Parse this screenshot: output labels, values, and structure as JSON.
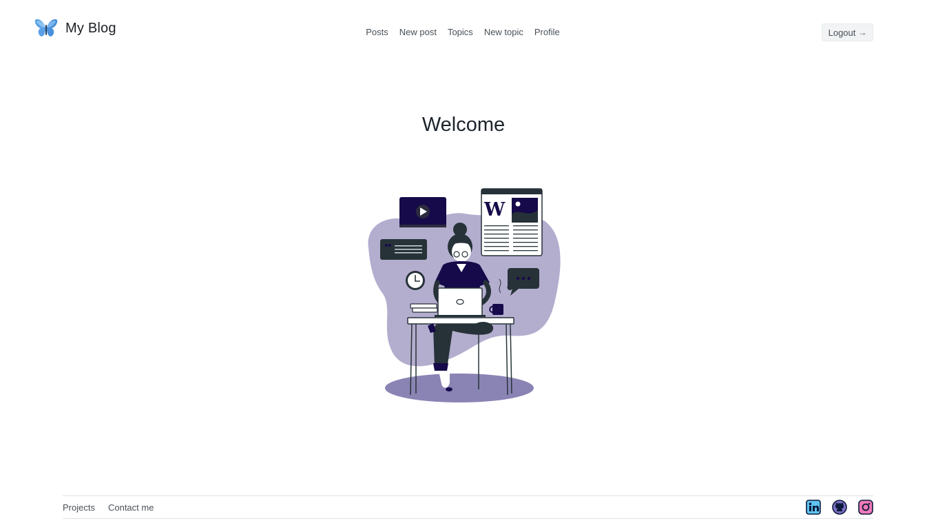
{
  "header": {
    "brand_name": "My Blog",
    "brand_icon": "butterfly-icon",
    "nav": [
      {
        "label": "Posts"
      },
      {
        "label": "New post"
      },
      {
        "label": "Topics"
      },
      {
        "label": "New topic"
      },
      {
        "label": "Profile"
      }
    ],
    "logout_label": "Logout",
    "logout_icon": "arrow-right-icon"
  },
  "main": {
    "title": "Welcome",
    "illustration": "woman-blogging-at-desk-illustration"
  },
  "footer": {
    "links": [
      {
        "label": "Projects"
      },
      {
        "label": "Contact me"
      }
    ],
    "socials": [
      "linkedin-icon",
      "github-icon",
      "instagram-icon"
    ]
  },
  "colors": {
    "accent_purple": "#b3adce",
    "dark_navy": "#160a4a",
    "shadow_purple": "#8a84b4",
    "text": "#212529"
  }
}
